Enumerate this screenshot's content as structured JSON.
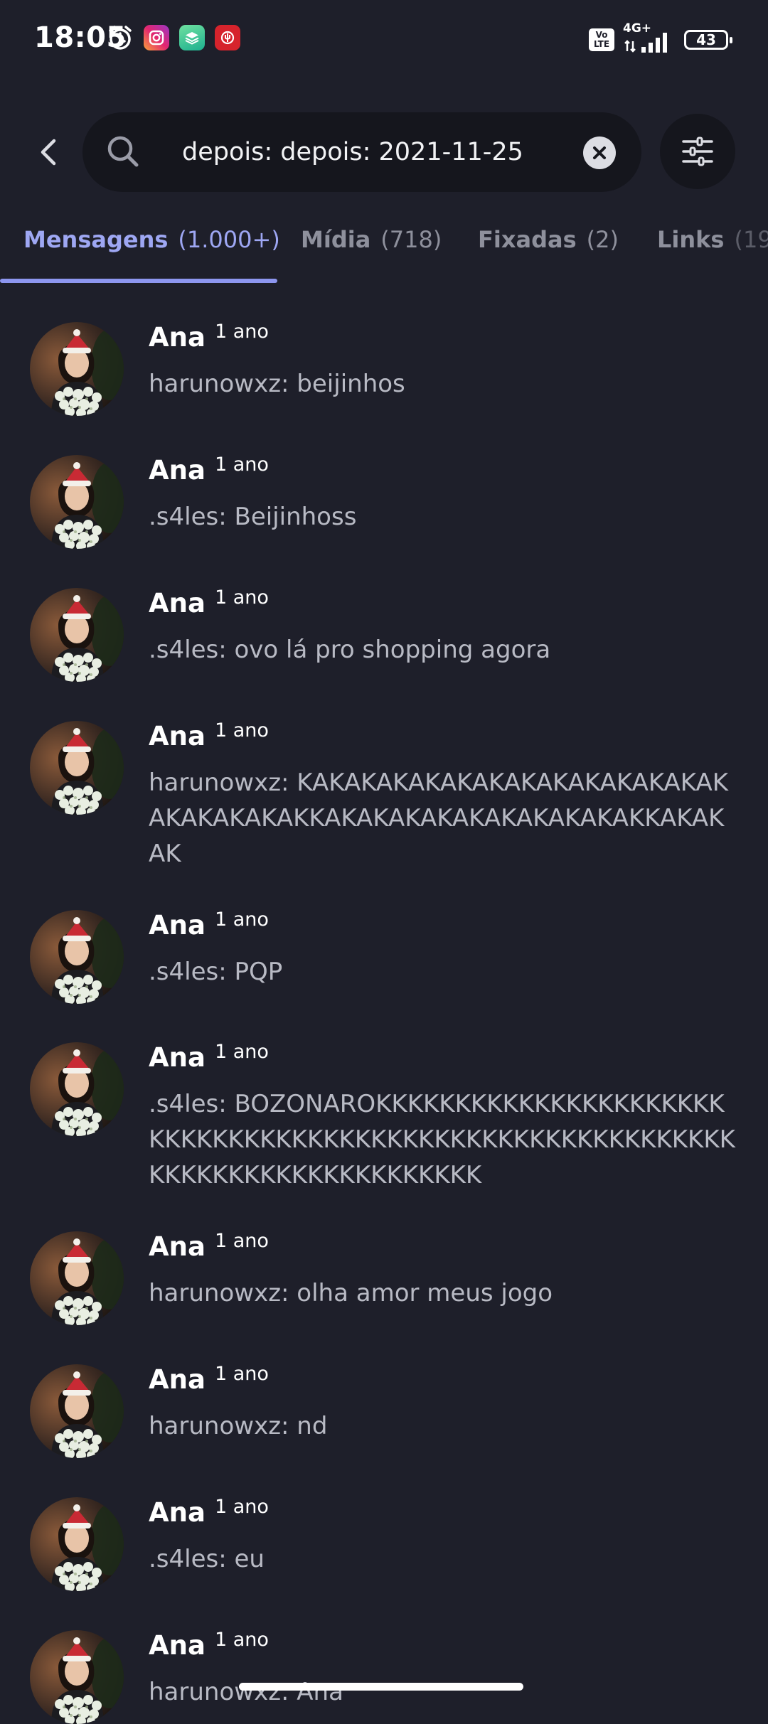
{
  "status_bar": {
    "time": "18:05",
    "volte": "Vo LTE",
    "network": "4G+",
    "battery": "43"
  },
  "search": {
    "query": "depois: depois: 2021-11-25"
  },
  "tabs": [
    {
      "label": "Mensagens",
      "count": "(1.000+)"
    },
    {
      "label": "Mídia",
      "count": "(718)"
    },
    {
      "label": "Fixadas",
      "count": "(2)"
    },
    {
      "label": "Links",
      "count": "(19"
    }
  ],
  "results": [
    {
      "author": "Ana",
      "time": "1 ano",
      "text": "harunowxz: beijinhos"
    },
    {
      "author": "Ana",
      "time": "1 ano",
      "text": ".s4les: Beijinhoss"
    },
    {
      "author": "Ana",
      "time": "1 ano",
      "text": ".s4les: ovo lá pro shopping agora"
    },
    {
      "author": "Ana",
      "time": "1 ano",
      "text": "harunowxz: KAKAKAKAKAKAKAKAKAKAKAKAKAKAKAKAKAKAKKAKAKAKAKAKAKAKAKAKAKKAKAKAK"
    },
    {
      "author": "Ana",
      "time": "1 ano",
      "text": ".s4les: PQP"
    },
    {
      "author": "Ana",
      "time": "1 ano",
      "text": ".s4les: BOZONAROKKKKKKKKKKKKKKKKKKKKKKKKKKKKKKKKKKKKKKKKKKKKKKKKKKKKKKKKKKKKKKKKKKKKKKKKKKKKKKKK"
    },
    {
      "author": "Ana",
      "time": "1 ano",
      "text": "harunowxz: olha amor meus jogo"
    },
    {
      "author": "Ana",
      "time": "1 ano",
      "text": "harunowxz: nd"
    },
    {
      "author": "Ana",
      "time": "1 ano",
      "text": ".s4les: eu"
    },
    {
      "author": "Ana",
      "time": "1 ano",
      "text": "harunowxz: Ana"
    }
  ]
}
